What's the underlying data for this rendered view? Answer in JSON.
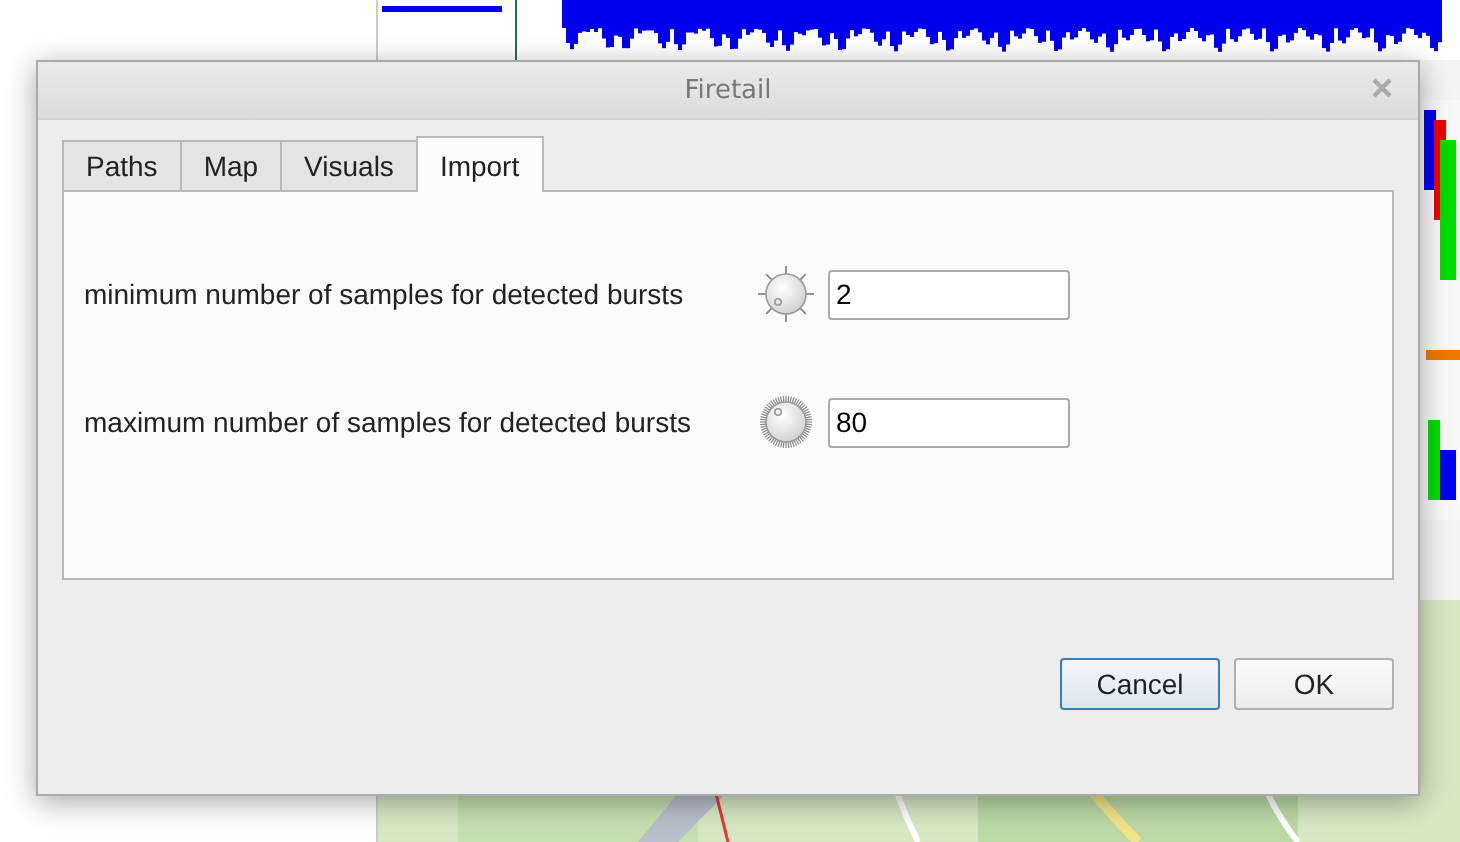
{
  "window": {
    "title": "Firetail"
  },
  "tabs": [
    {
      "label": "Paths",
      "selected": false
    },
    {
      "label": "Map",
      "selected": false
    },
    {
      "label": "Visuals",
      "selected": false
    },
    {
      "label": "Import",
      "selected": true
    }
  ],
  "settings": [
    {
      "label": "minimum number of samples for detected bursts",
      "kind": "coarse",
      "value": "2"
    },
    {
      "label": "maximum number of samples for detected bursts",
      "kind": "fine",
      "value": "80"
    }
  ],
  "buttons": [
    {
      "label": "Cancel",
      "kind": "default"
    },
    {
      "label": "OK",
      "kind": "normal"
    }
  ]
}
